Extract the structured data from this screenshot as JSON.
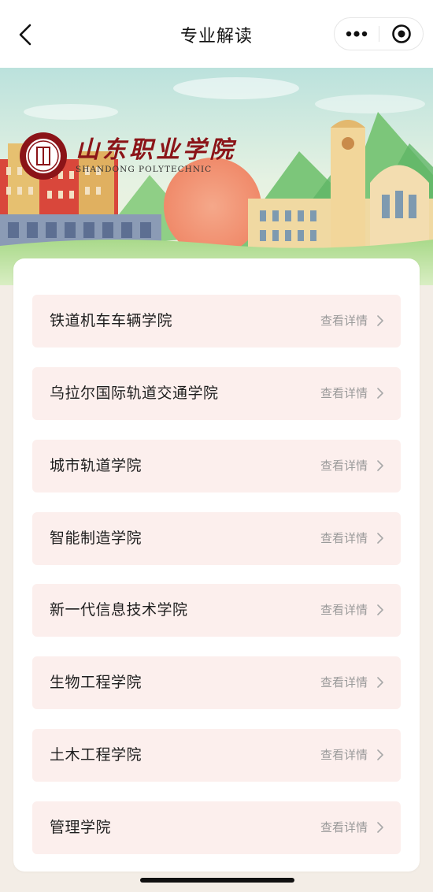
{
  "nav": {
    "title": "专业解读",
    "back_icon": "chevron-left-icon",
    "more_icon": "more-dots-icon",
    "close_icon": "target-icon"
  },
  "banner": {
    "school_name_cn": "山东职业学院",
    "school_name_en": "SHANDONG POLYTECHNIC"
  },
  "colleges": [
    {
      "name": "铁道机车车辆学院",
      "detail": "查看详情"
    },
    {
      "name": "乌拉尔国际轨道交通学院",
      "detail": "查看详情"
    },
    {
      "name": "城市轨道学院",
      "detail": "查看详情"
    },
    {
      "name": "智能制造学院",
      "detail": "查看详情"
    },
    {
      "name": "新一代信息技术学院",
      "detail": "查看详情"
    },
    {
      "name": "生物工程学院",
      "detail": "查看详情"
    },
    {
      "name": "土木工程学院",
      "detail": "查看详情"
    },
    {
      "name": "管理学院",
      "detail": "查看详情"
    }
  ],
  "colors": {
    "item_bg": "#fcefed",
    "accent": "#8b1418"
  }
}
